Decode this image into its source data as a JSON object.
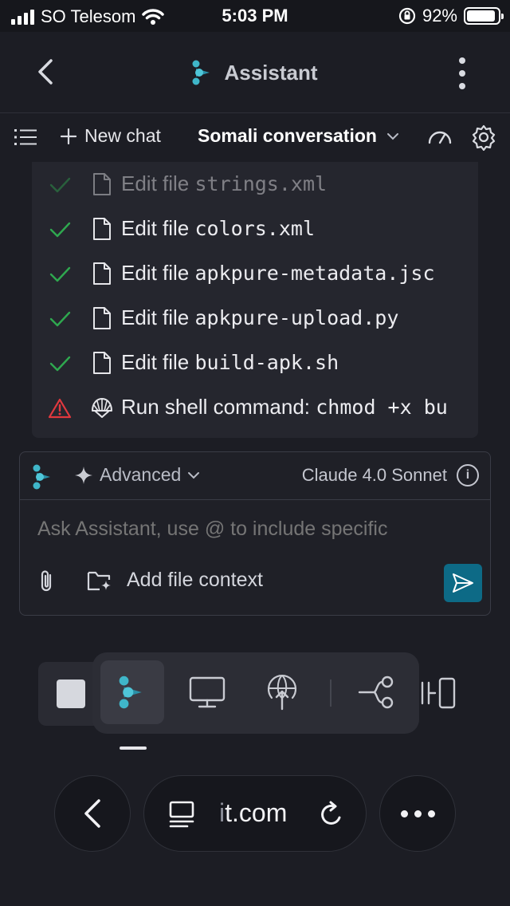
{
  "status_bar": {
    "carrier": "SO Telesom",
    "time": "5:03 PM",
    "battery": "92%",
    "battery_level": 0.92
  },
  "app_bar": {
    "title": "Assistant",
    "back_icon": "chevron-left-icon",
    "menu_icon": "kebab-menu-icon"
  },
  "toolbar": {
    "new_chat": "New chat",
    "conversation": "Somali conversation"
  },
  "steps": [
    {
      "status": "done",
      "label": "Edit file",
      "target": "strings.xml",
      "icon": "file-icon"
    },
    {
      "status": "done",
      "label": "Edit file",
      "target": "colors.xml",
      "icon": "file-icon"
    },
    {
      "status": "done",
      "label": "Edit file",
      "target": "apkpure-metadata.jsc",
      "icon": "file-icon"
    },
    {
      "status": "done",
      "label": "Edit file",
      "target": "apkpure-upload.py",
      "icon": "file-icon"
    },
    {
      "status": "done",
      "label": "Edit file",
      "target": "build-apk.sh",
      "icon": "file-icon"
    },
    {
      "status": "warning",
      "label": "Run shell command:",
      "target": "chmod +x bu",
      "icon": "shell-icon"
    }
  ],
  "chat": {
    "mode": "Advanced",
    "model": "Claude 4.0 Sonnet",
    "placeholder": "Ask Assistant, use @ to include specific",
    "add_context": "Add file context"
  },
  "browser": {
    "url_prefix": "i",
    "url_rest": "t.com"
  },
  "colors": {
    "accent": "#0d6a86",
    "success": "#2fa84f",
    "danger": "#e0383e",
    "logo": "#3fb6c9"
  }
}
